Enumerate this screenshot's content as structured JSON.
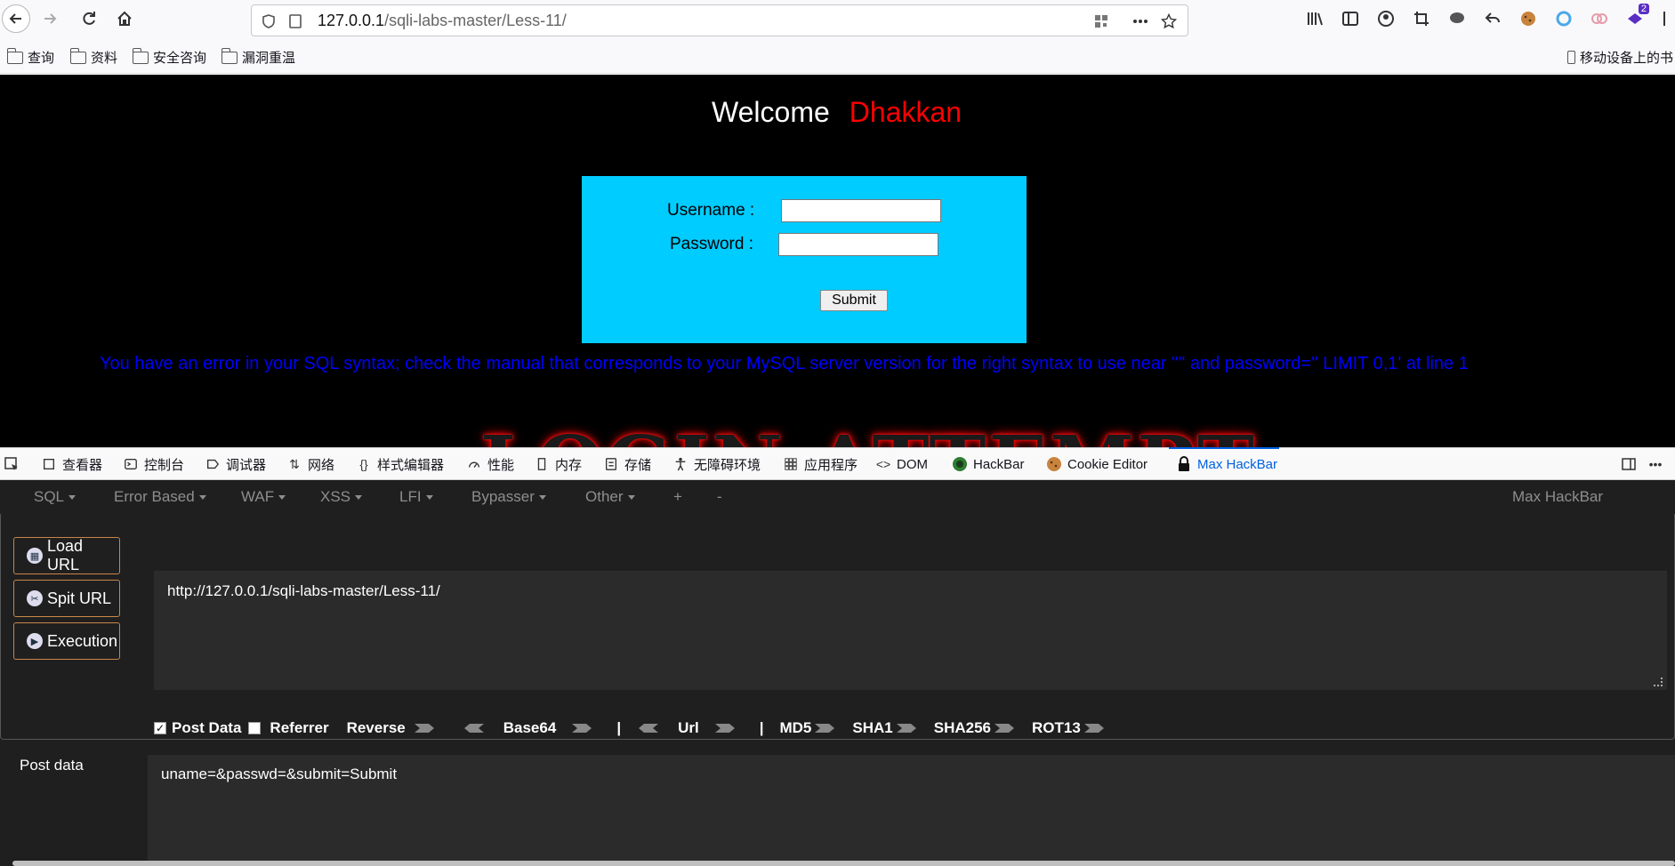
{
  "browser": {
    "url_host": "127.0.0.1",
    "url_path": "/sqli-labs-master/Less-11/",
    "extension_badge": "2"
  },
  "bookmarks": [
    {
      "label": "查询"
    },
    {
      "label": "资料"
    },
    {
      "label": "安全咨询"
    },
    {
      "label": "漏洞重温"
    }
  ],
  "bookmarks_right": "移动设备上的书",
  "page": {
    "welcome": "Welcome",
    "user_name": "Dhakkan",
    "username_label": "Username :",
    "password_label": "Password :",
    "username_value": "",
    "password_value": "",
    "submit_label": "Submit",
    "sql_error": "You have an error in your SQL syntax; check the manual that corresponds to your MySQL server version for the right syntax to use near '''' and password='' LIMIT 0,1' at line 1",
    "banner": "LOGIN ATTEMPT"
  },
  "devtools": {
    "tabs": [
      "查看器",
      "控制台",
      "调试器",
      "网络",
      "样式编辑器",
      "性能",
      "内存",
      "存储",
      "无障碍环境",
      "应用程序",
      "DOM",
      "HackBar",
      "Cookie Editor",
      "Max HackBar"
    ],
    "active_tab": "Max HackBar"
  },
  "hackbar": {
    "menu": [
      "SQL",
      "Error Based",
      "WAF",
      "XSS",
      "LFI",
      "Bypasser",
      "Other",
      "+",
      "-"
    ],
    "title": "Max HackBar",
    "buttons": {
      "load": "Load URL",
      "split": "Spit URL",
      "execute": "Execution"
    },
    "url": "http://127.0.0.1/sqli-labs-master/Less-11/",
    "options": {
      "post_data": "Post Data",
      "post_data_checked": true,
      "referrer": "Referrer",
      "referrer_checked": false,
      "reverse": "Reverse",
      "base64": "Base64",
      "sep": "|",
      "url": "Url",
      "md5": "MD5",
      "sha1": "SHA1",
      "sha256": "SHA256",
      "rot13": "ROT13"
    },
    "post_label": "Post data",
    "post_value": "uname=&passwd=&submit=Submit"
  },
  "colors": {
    "page_bg": "#000000",
    "login_box": "#00ccff",
    "error_text": "#0000ff",
    "name_red": "#ff0000",
    "hackbar_bg": "#1f1f1f",
    "active_tab": "#0061e0"
  }
}
